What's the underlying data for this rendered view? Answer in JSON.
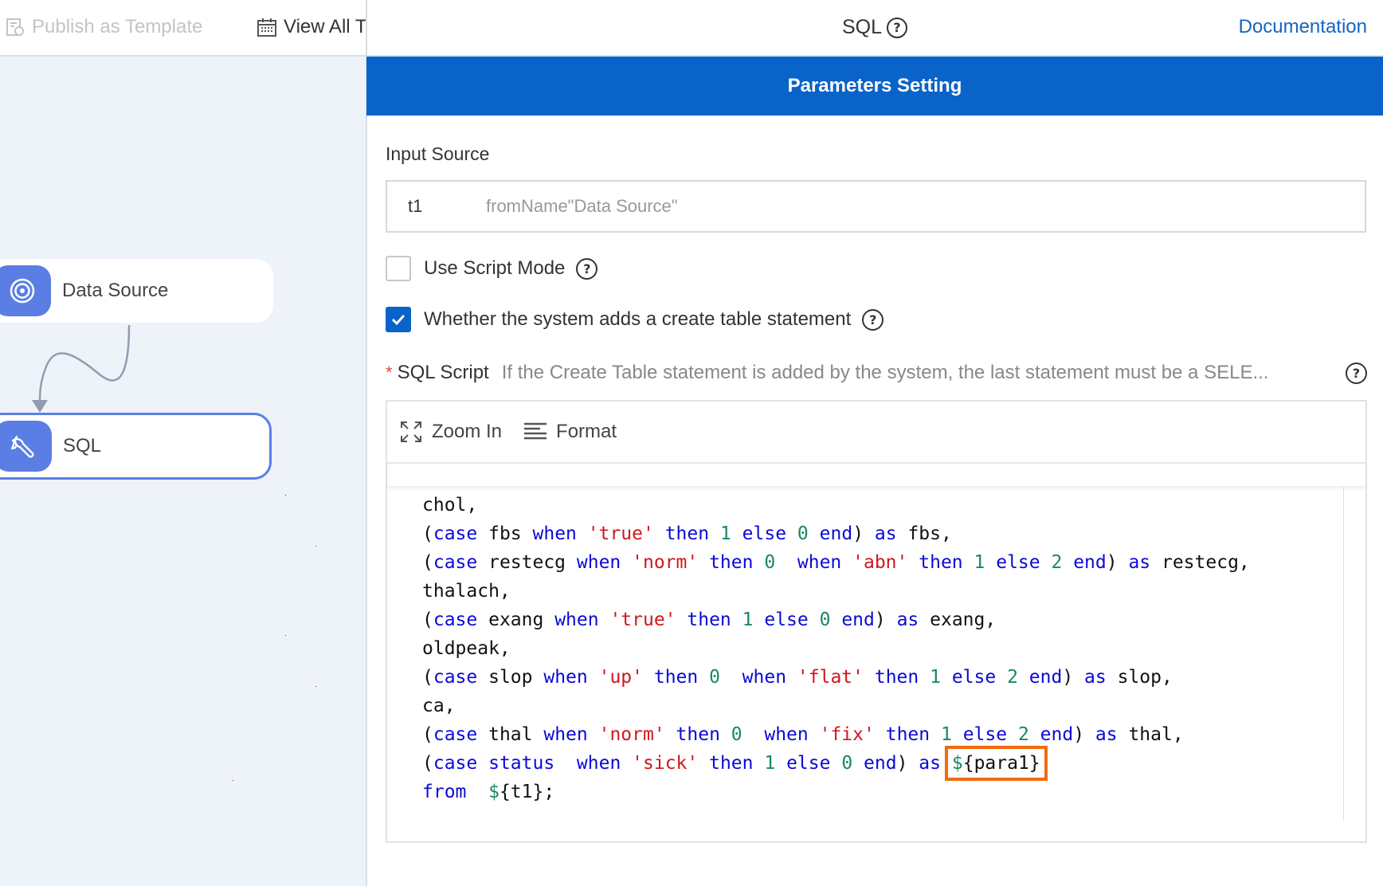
{
  "toolbar": {
    "publish_template": "Publish as Template",
    "view_all": "View All T"
  },
  "canvas": {
    "nodes": [
      {
        "label": "Data Source",
        "icon": "target-icon",
        "selected": false
      },
      {
        "label": "SQL",
        "icon": "wrench-icon",
        "selected": true
      }
    ]
  },
  "panel": {
    "title": "SQL",
    "documentation_link": "Documentation",
    "section_title": "Parameters Setting",
    "input_source": {
      "label": "Input Source",
      "key": "t1",
      "value": "fromName\"Data Source\""
    },
    "use_script_mode": {
      "label": "Use Script Mode",
      "checked": false
    },
    "create_table": {
      "label": "Whether the system adds a create table statement",
      "checked": true
    },
    "sql_script": {
      "required_mark": "*",
      "label": "SQL Script",
      "hint": "If the Create Table statement is added by the system, the last statement must be a SELE..."
    },
    "editor_toolbar": {
      "zoom_in": "Zoom In",
      "format": "Format"
    },
    "code_lines": [
      [
        [
          "t",
          "chol,"
        ]
      ],
      [
        [
          "t",
          "("
        ],
        [
          "k",
          "case"
        ],
        [
          "t",
          " fbs "
        ],
        [
          "k",
          "when"
        ],
        [
          "t",
          " "
        ],
        [
          "s",
          "'true'"
        ],
        [
          "t",
          " "
        ],
        [
          "k",
          "then"
        ],
        [
          "t",
          " "
        ],
        [
          "n",
          "1"
        ],
        [
          "t",
          " "
        ],
        [
          "k",
          "else"
        ],
        [
          "t",
          " "
        ],
        [
          "n",
          "0"
        ],
        [
          "t",
          " "
        ],
        [
          "k",
          "end"
        ],
        [
          "t",
          ") "
        ],
        [
          "k",
          "as"
        ],
        [
          "t",
          " fbs,"
        ]
      ],
      [
        [
          "t",
          "("
        ],
        [
          "k",
          "case"
        ],
        [
          "t",
          " restecg "
        ],
        [
          "k",
          "when"
        ],
        [
          "t",
          " "
        ],
        [
          "s",
          "'norm'"
        ],
        [
          "t",
          " "
        ],
        [
          "k",
          "then"
        ],
        [
          "t",
          " "
        ],
        [
          "n",
          "0"
        ],
        [
          "t",
          "  "
        ],
        [
          "k",
          "when"
        ],
        [
          "t",
          " "
        ],
        [
          "s",
          "'abn'"
        ],
        [
          "t",
          " "
        ],
        [
          "k",
          "then"
        ],
        [
          "t",
          " "
        ],
        [
          "n",
          "1"
        ],
        [
          "t",
          " "
        ],
        [
          "k",
          "else"
        ],
        [
          "t",
          " "
        ],
        [
          "n",
          "2"
        ],
        [
          "t",
          " "
        ],
        [
          "k",
          "end"
        ],
        [
          "t",
          ") "
        ],
        [
          "k",
          "as"
        ],
        [
          "t",
          " restecg,"
        ]
      ],
      [
        [
          "t",
          "thalach,"
        ]
      ],
      [
        [
          "t",
          "("
        ],
        [
          "k",
          "case"
        ],
        [
          "t",
          " exang "
        ],
        [
          "k",
          "when"
        ],
        [
          "t",
          " "
        ],
        [
          "s",
          "'true'"
        ],
        [
          "t",
          " "
        ],
        [
          "k",
          "then"
        ],
        [
          "t",
          " "
        ],
        [
          "n",
          "1"
        ],
        [
          "t",
          " "
        ],
        [
          "k",
          "else"
        ],
        [
          "t",
          " "
        ],
        [
          "n",
          "0"
        ],
        [
          "t",
          " "
        ],
        [
          "k",
          "end"
        ],
        [
          "t",
          ") "
        ],
        [
          "k",
          "as"
        ],
        [
          "t",
          " exang,"
        ]
      ],
      [
        [
          "t",
          "oldpeak,"
        ]
      ],
      [
        [
          "t",
          "("
        ],
        [
          "k",
          "case"
        ],
        [
          "t",
          " slop "
        ],
        [
          "k",
          "when"
        ],
        [
          "t",
          " "
        ],
        [
          "s",
          "'up'"
        ],
        [
          "t",
          " "
        ],
        [
          "k",
          "then"
        ],
        [
          "t",
          " "
        ],
        [
          "n",
          "0"
        ],
        [
          "t",
          "  "
        ],
        [
          "k",
          "when"
        ],
        [
          "t",
          " "
        ],
        [
          "s",
          "'flat'"
        ],
        [
          "t",
          " "
        ],
        [
          "k",
          "then"
        ],
        [
          "t",
          " "
        ],
        [
          "n",
          "1"
        ],
        [
          "t",
          " "
        ],
        [
          "k",
          "else"
        ],
        [
          "t",
          " "
        ],
        [
          "n",
          "2"
        ],
        [
          "t",
          " "
        ],
        [
          "k",
          "end"
        ],
        [
          "t",
          ") "
        ],
        [
          "k",
          "as"
        ],
        [
          "t",
          " slop,"
        ]
      ],
      [
        [
          "t",
          "ca,"
        ]
      ],
      [
        [
          "t",
          "("
        ],
        [
          "k",
          "case"
        ],
        [
          "t",
          " thal "
        ],
        [
          "k",
          "when"
        ],
        [
          "t",
          " "
        ],
        [
          "s",
          "'norm'"
        ],
        [
          "t",
          " "
        ],
        [
          "k",
          "then"
        ],
        [
          "t",
          " "
        ],
        [
          "n",
          "0"
        ],
        [
          "t",
          "  "
        ],
        [
          "k",
          "when"
        ],
        [
          "t",
          " "
        ],
        [
          "s",
          "'fix'"
        ],
        [
          "t",
          " "
        ],
        [
          "k",
          "then"
        ],
        [
          "t",
          " "
        ],
        [
          "n",
          "1"
        ],
        [
          "t",
          " "
        ],
        [
          "k",
          "else"
        ],
        [
          "t",
          " "
        ],
        [
          "n",
          "2"
        ],
        [
          "t",
          " "
        ],
        [
          "k",
          "end"
        ],
        [
          "t",
          ") "
        ],
        [
          "k",
          "as"
        ],
        [
          "t",
          " thal,"
        ]
      ],
      [
        [
          "t",
          "("
        ],
        [
          "k",
          "case"
        ],
        [
          "t",
          " "
        ],
        [
          "k",
          "status"
        ],
        [
          "t",
          "  "
        ],
        [
          "k",
          "when"
        ],
        [
          "t",
          " "
        ],
        [
          "s",
          "'sick'"
        ],
        [
          "t",
          " "
        ],
        [
          "k",
          "then"
        ],
        [
          "t",
          " "
        ],
        [
          "n",
          "1"
        ],
        [
          "t",
          " "
        ],
        [
          "k",
          "else"
        ],
        [
          "t",
          " "
        ],
        [
          "n",
          "0"
        ],
        [
          "t",
          " "
        ],
        [
          "k",
          "end"
        ],
        [
          "t",
          ") "
        ],
        [
          "k",
          "as"
        ],
        [
          "t",
          " "
        ],
        [
          "h",
          "${para1}"
        ]
      ],
      [
        [
          "k",
          "from"
        ],
        [
          "t",
          "  "
        ],
        [
          "v",
          "$"
        ],
        [
          "t",
          "{t1};"
        ]
      ]
    ],
    "highlighted_token": "${para1}"
  },
  "colors": {
    "brand_blue": "#0a63c9",
    "node_blue": "#5b7ee5",
    "highlight_orange": "#f26b0f",
    "keyword": "#0a0ad6",
    "string": "#d0171b",
    "number": "#178a5c"
  }
}
